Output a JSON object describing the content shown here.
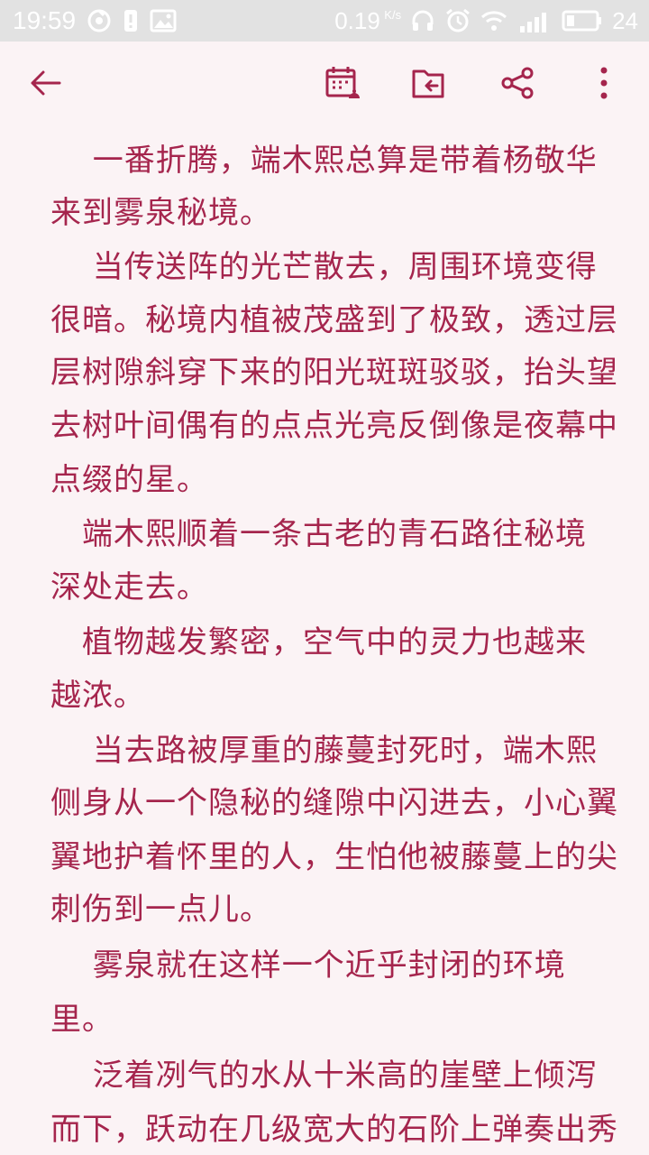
{
  "status_bar": {
    "time": "19:59",
    "network_speed": "0.19",
    "network_speed_unit": "K/s",
    "battery_percent": "24"
  },
  "toolbar": {
    "icons": [
      "back-arrow-icon",
      "calendar-alarm-icon",
      "folder-return-icon",
      "share-icon",
      "more-vertical-icon"
    ]
  },
  "content": {
    "color": "#a5254d",
    "lines": [
      "　 一番折腾，端木熙总算是带着杨敬华",
      "来到雾泉秘境。",
      "　 当传送阵的光芒散去，周围环境变得",
      "很暗。秘境内植被茂盛到了极致，透过层",
      "层树隙斜穿下来的阳光斑斑驳驳，抬头望",
      "去树叶间偶有的点点光亮反倒像是夜幕中",
      "点缀的星。",
      "　端木熙顺着一条古老的青石路往秘境",
      "深处走去。",
      "　植物越发繁密，空气中的灵力也越来",
      "越浓。",
      "　 当去路被厚重的藤蔓封死时，端木熙",
      "侧身从一个隐秘的缝隙中闪进去，小心翼",
      "翼地护着怀里的人，生怕他被藤蔓上的尖",
      "刺伤到一点儿。",
      "　 雾泉就在这样一个近乎封闭的环境",
      "里。",
      "　 泛着冽气的水从十米高的崖壁上倾泻",
      "而下，跃动在几级宽大的石阶上弹奏出秀"
    ]
  }
}
